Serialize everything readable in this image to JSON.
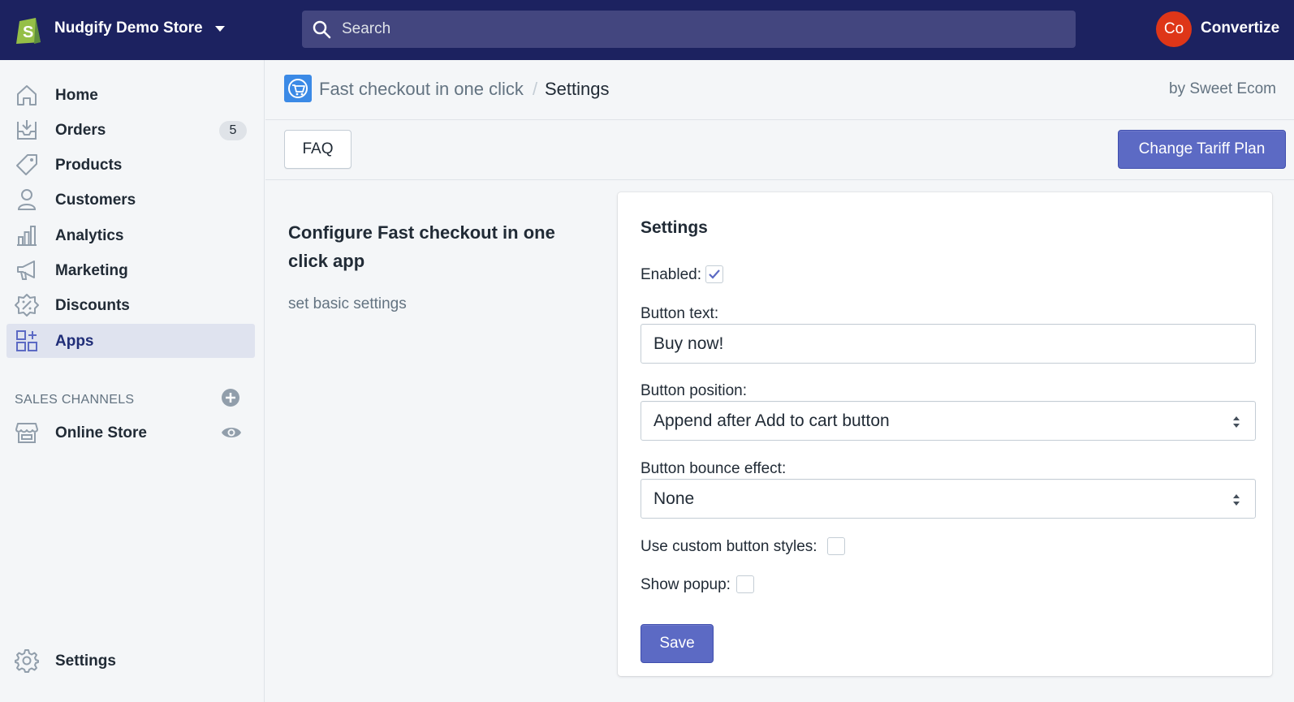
{
  "topbar": {
    "store_name": "Nudgify Demo Store",
    "search_placeholder": "Search",
    "avatar_initials": "Co",
    "account_name": "Convertize"
  },
  "sidebar": {
    "items": [
      {
        "label": "Home",
        "icon": "home-icon"
      },
      {
        "label": "Orders",
        "icon": "orders-icon",
        "badge": "5"
      },
      {
        "label": "Products",
        "icon": "tag-icon"
      },
      {
        "label": "Customers",
        "icon": "person-icon"
      },
      {
        "label": "Analytics",
        "icon": "bar-chart-icon"
      },
      {
        "label": "Marketing",
        "icon": "megaphone-icon"
      },
      {
        "label": "Discounts",
        "icon": "discount-icon"
      },
      {
        "label": "Apps",
        "icon": "apps-icon",
        "active": true
      }
    ],
    "channels_heading": "SALES CHANNELS",
    "online_store": "Online Store",
    "settings": "Settings"
  },
  "header": {
    "app_name": "Fast checkout in one click",
    "separator": "/",
    "page": "Settings",
    "by_line": "by Sweet Ecom"
  },
  "toolbar": {
    "faq": "FAQ",
    "change_plan": "Change Tariff Plan"
  },
  "section": {
    "title": "Configure Fast checkout in one click app",
    "description": "set basic settings"
  },
  "settings": {
    "title": "Settings",
    "enabled_label": "Enabled:",
    "enabled": true,
    "button_text_label": "Button text:",
    "button_text_value": "Buy now!",
    "button_position_label": "Button position:",
    "button_position_value": "Append after Add to cart button",
    "bounce_label": "Button bounce effect:",
    "bounce_value": "None",
    "custom_styles_label": "Use custom button styles:",
    "custom_styles": false,
    "popup_label": "Show popup:",
    "popup": false,
    "save": "Save"
  },
  "colors": {
    "topbar": "#1c2260",
    "primary": "#5c6ac4",
    "avatar": "#de3618"
  }
}
